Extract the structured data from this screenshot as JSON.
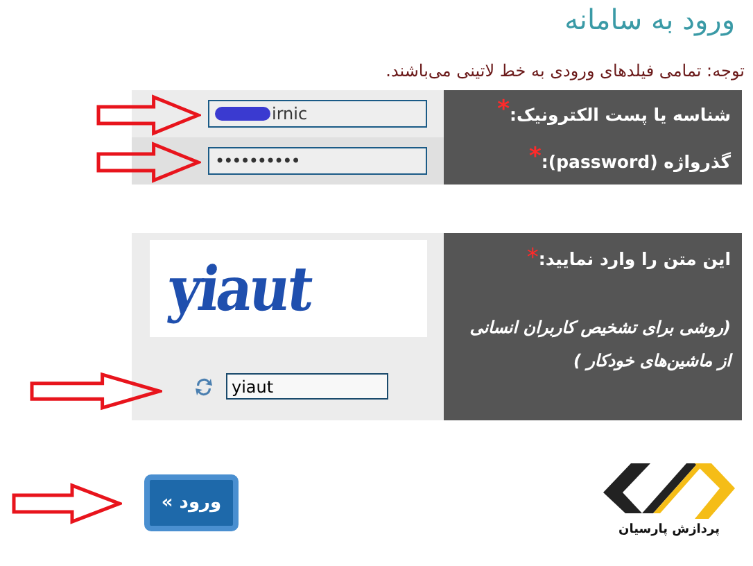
{
  "title": "ورود به سامانه",
  "notice": "توجه: تمامی فیلدهای ورودی به خط لاتینی می‌باشند.",
  "fields": [
    {
      "kind": "text",
      "label": "شناسه یا پست الکترونیک:",
      "marker": "*",
      "value": "irnic",
      "redacted": true
    },
    {
      "kind": "password",
      "label": "گذرواژه (password):",
      "marker": "*",
      "value": "••••••••••",
      "redacted": false
    }
  ],
  "captcha": {
    "label": "این متن را وارد نمایید:",
    "marker": "*",
    "hint": "(روشی برای تشخیص کاربران انسانی از ماشین‌های خودکار )",
    "image_text": "yiaut",
    "value": "yiaut"
  },
  "submit_button": "ورود »",
  "logo_text": "پردازش پارسیان"
}
